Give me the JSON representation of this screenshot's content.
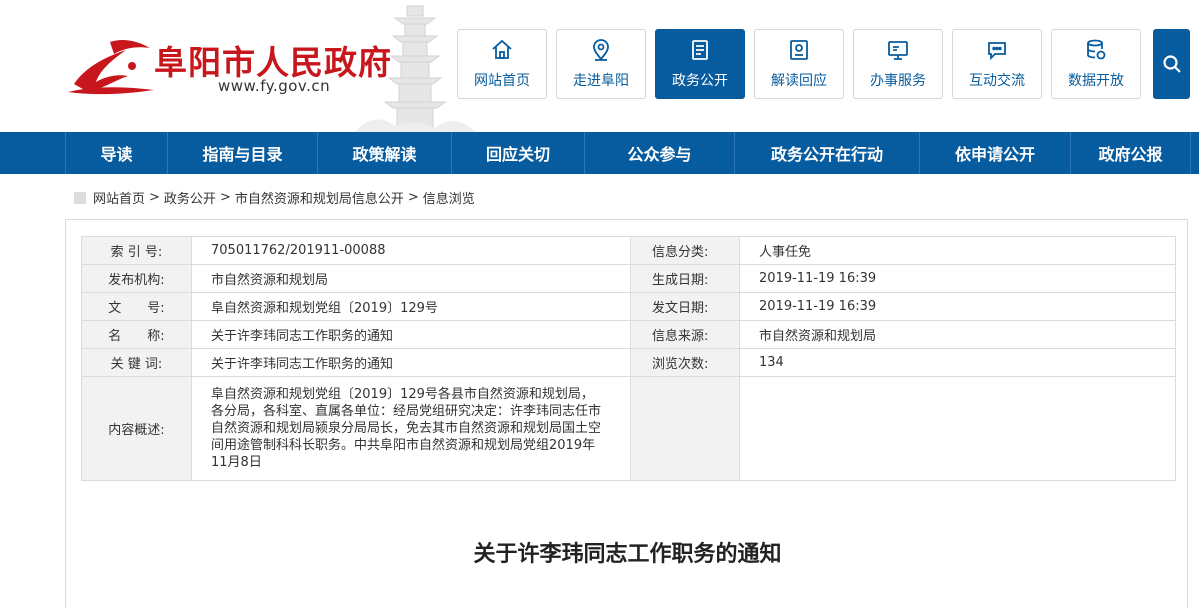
{
  "header": {
    "site_title": "阜阳市人民政府",
    "site_url": "www.fy.gov.cn",
    "brand_color": "#c8161d",
    "accent_color": "#075b9f"
  },
  "top_nav": [
    {
      "label": "网站首页",
      "icon": "home-icon",
      "active": false
    },
    {
      "label": "走进阜阳",
      "icon": "location-pin-icon",
      "active": false
    },
    {
      "label": "政务公开",
      "icon": "document-icon",
      "active": true
    },
    {
      "label": "解读回应",
      "icon": "reading-icon",
      "active": false
    },
    {
      "label": "办事服务",
      "icon": "monitor-icon",
      "active": false
    },
    {
      "label": "互动交流",
      "icon": "chat-icon",
      "active": false
    },
    {
      "label": "数据开放",
      "icon": "database-icon",
      "active": false
    }
  ],
  "search": {
    "icon": "search-icon"
  },
  "main_nav": [
    "导读",
    "指南与目录",
    "政策解读",
    "回应关切",
    "公众参与",
    "政务公开在行动",
    "依申请公开",
    "政府公报"
  ],
  "breadcrumb": [
    "网站首页",
    "政务公开",
    "市自然资源和规划局信息公开",
    "信息浏览"
  ],
  "info_table": {
    "index_label": "索 引 号:",
    "index_value": "705011762/201911-00088",
    "category_label": "信息分类:",
    "category_value": "人事任免",
    "publisher_label": "发布机构:",
    "publisher_value": "市自然资源和规划局",
    "created_label": "生成日期:",
    "created_value": "2019-11-19 16:39",
    "docno_label": "文　　号:",
    "docno_value": "阜自然资源和规划党组〔2019〕129号",
    "issued_label": "发文日期:",
    "issued_value": "2019-11-19 16:39",
    "name_label": "名　　称:",
    "name_value": "关于许李玮同志工作职务的通知",
    "source_label": "信息来源:",
    "source_value": "市自然资源和规划局",
    "keywords_label": "关 键 词:",
    "keywords_value": "关于许李玮同志工作职务的通知",
    "views_label": "浏览次数:",
    "views_value": "134",
    "summary_label": "内容概述:",
    "summary_value": "阜自然资源和规划党组〔2019〕129号各县市自然资源和规划局，各分局，各科室、直属各单位：经局党组研究决定：许李玮同志任市自然资源和规划局颍泉分局局长，免去其市自然资源和规划局国土空间用途管制科科长职务。中共阜阳市自然资源和规划局党组2019年11月8日"
  },
  "document_title": "关于许李玮同志工作职务的通知"
}
